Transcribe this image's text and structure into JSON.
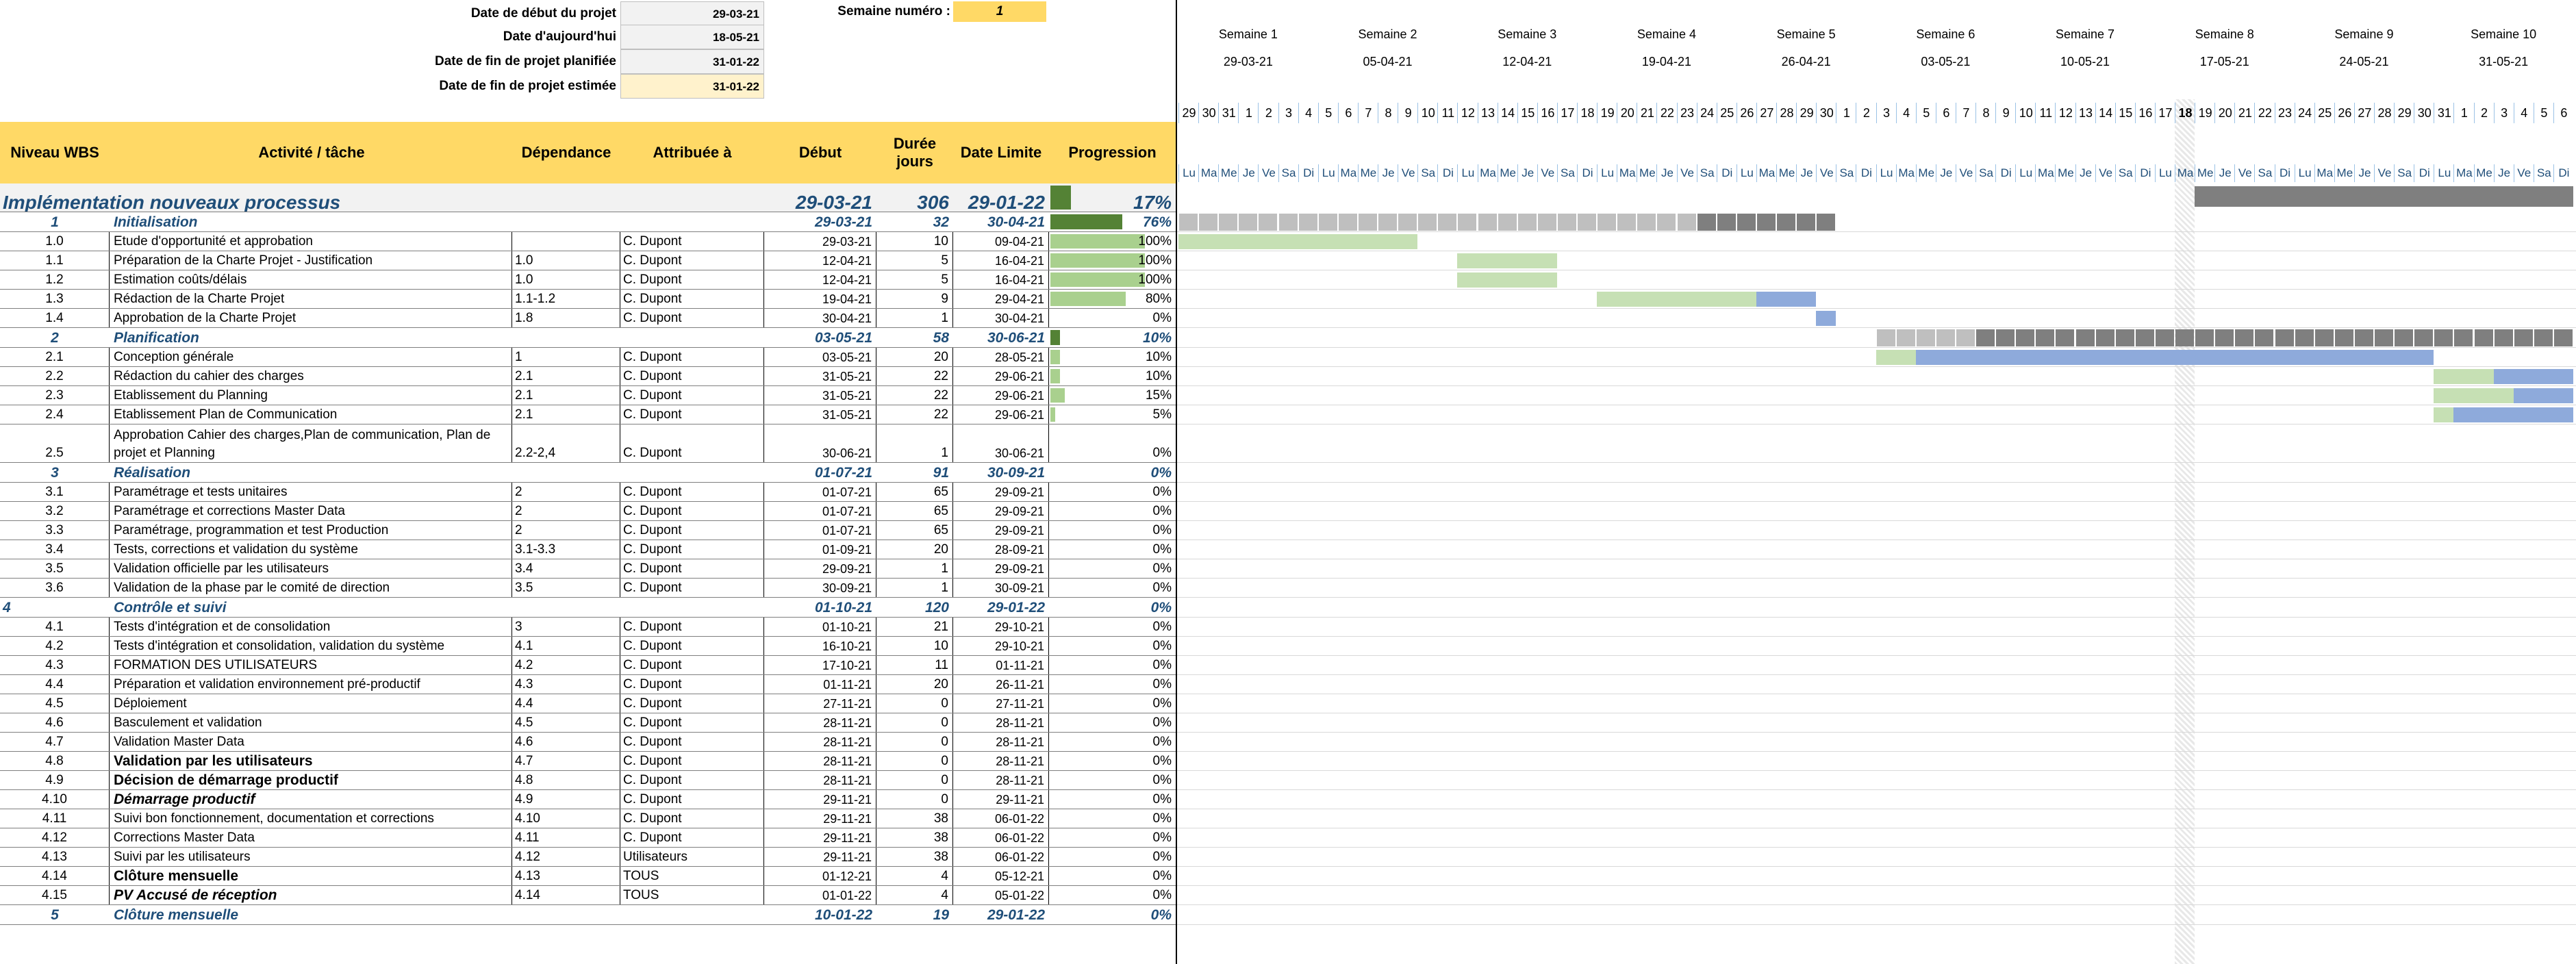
{
  "top": {
    "labels": [
      "Date de début du projet",
      "Date d'aujourd'hui",
      "Date de fin de projet planifiée",
      "Date de fin de projet estimée"
    ],
    "values": [
      "29-03-21",
      "18-05-21",
      "31-01-22",
      "31-01-22"
    ],
    "week_label": "Semaine numéro :",
    "week_value": "1"
  },
  "headers": {
    "wbs": "Niveau WBS",
    "activity": "Activité / tâche",
    "dependance": "Dépendance",
    "assigned": "Attribuée à",
    "start": "Début",
    "duration": "Durée jours",
    "deadline": "Date Limite",
    "progress": "Progression"
  },
  "project": {
    "name": "Implémentation nouveaux processus",
    "start": "29-03-21",
    "duration": "306",
    "deadline": "29-01-22",
    "progress": "17%",
    "progress_value": 17
  },
  "rows": [
    {
      "type": "phase",
      "wbs": "1",
      "task": "Initialisation",
      "dep": "",
      "who": "",
      "start": "29-03-21",
      "dur": "32",
      "end": "30-04-21",
      "prog": "76%",
      "pv": 76
    },
    {
      "type": "task",
      "wbs": "1.0",
      "task": "Etude d'opportunité et approbation",
      "dep": "",
      "who": "C. Dupont",
      "start": "29-03-21",
      "dur": "10",
      "end": "09-04-21",
      "prog": "100%",
      "pv": 100
    },
    {
      "type": "task",
      "wbs": "1.1",
      "task": "Préparation de la Charte Projet - Justification",
      "dep": "1.0",
      "who": "C. Dupont",
      "start": "12-04-21",
      "dur": "5",
      "end": "16-04-21",
      "prog": "100%",
      "pv": 100
    },
    {
      "type": "task",
      "wbs": "1.2",
      "task": "Estimation coûts/délais",
      "dep": "1.0",
      "who": "C. Dupont",
      "start": "12-04-21",
      "dur": "5",
      "end": "16-04-21",
      "prog": "100%",
      "pv": 100
    },
    {
      "type": "task",
      "wbs": "1.3",
      "task": "Rédaction de la Charte Projet",
      "dep": "1.1-1.2",
      "who": "C. Dupont",
      "start": "19-04-21",
      "dur": "9",
      "end": "29-04-21",
      "prog": "80%",
      "pv": 80
    },
    {
      "type": "task",
      "wbs": "1.4",
      "task": "Approbation de la Charte Projet",
      "dep": "1.8",
      "who": "C. Dupont",
      "start": "30-04-21",
      "dur": "1",
      "end": "30-04-21",
      "prog": "0%",
      "pv": 0
    },
    {
      "type": "phase",
      "wbs": "2",
      "task": "Planification",
      "dep": "",
      "who": "",
      "start": "03-05-21",
      "dur": "58",
      "end": "30-06-21",
      "prog": "10%",
      "pv": 10
    },
    {
      "type": "task",
      "wbs": "2.1",
      "task": "Conception générale",
      "dep": "1",
      "who": "C. Dupont",
      "start": "03-05-21",
      "dur": "20",
      "end": "28-05-21",
      "prog": "10%",
      "pv": 10
    },
    {
      "type": "task",
      "wbs": "2.2",
      "task": "Rédaction du cahier des charges",
      "dep": "2.1",
      "who": "C. Dupont",
      "start": "31-05-21",
      "dur": "22",
      "end": "29-06-21",
      "prog": "10%",
      "pv": 10
    },
    {
      "type": "task",
      "wbs": "2.3",
      "task": "Etablissement du Planning",
      "dep": "2.1",
      "who": "C. Dupont",
      "start": "31-05-21",
      "dur": "22",
      "end": "29-06-21",
      "prog": "15%",
      "pv": 15
    },
    {
      "type": "task",
      "wbs": "2.4",
      "task": "Etablissement Plan de Communication",
      "dep": "2.1",
      "who": "C. Dupont",
      "start": "31-05-21",
      "dur": "22",
      "end": "29-06-21",
      "prog": "5%",
      "pv": 5
    },
    {
      "type": "task2",
      "wbs": "2.5",
      "task": "Approbation Cahier des charges,Plan de communication, Plan de projet et Planning",
      "dep": "2.2-2,4",
      "who": "C. Dupont",
      "start": "30-06-21",
      "dur": "1",
      "end": "30-06-21",
      "prog": "0%",
      "pv": 0
    },
    {
      "type": "phase",
      "wbs": "3",
      "task": "Réalisation",
      "dep": "",
      "who": "",
      "start": "01-07-21",
      "dur": "91",
      "end": "30-09-21",
      "prog": "0%",
      "pv": 0
    },
    {
      "type": "task",
      "wbs": "3.1",
      "task": "Paramétrage et tests unitaires",
      "dep": "2",
      "who": "C. Dupont",
      "start": "01-07-21",
      "dur": "65",
      "end": "29-09-21",
      "prog": "0%",
      "pv": 0
    },
    {
      "type": "task",
      "wbs": "3.2",
      "task": "Paramétrage et corrections Master Data",
      "dep": "2",
      "who": "C. Dupont",
      "start": "01-07-21",
      "dur": "65",
      "end": "29-09-21",
      "prog": "0%",
      "pv": 0
    },
    {
      "type": "task",
      "wbs": "3.3",
      "task": "Paramétrage, programmation et test Production",
      "dep": "2",
      "who": "C. Dupont",
      "start": "01-07-21",
      "dur": "65",
      "end": "29-09-21",
      "prog": "0%",
      "pv": 0
    },
    {
      "type": "task",
      "wbs": "3.4",
      "task": "Tests, corrections et validation du système",
      "dep": "3.1-3.3",
      "who": "C. Dupont",
      "start": "01-09-21",
      "dur": "20",
      "end": "28-09-21",
      "prog": "0%",
      "pv": 0
    },
    {
      "type": "task",
      "wbs": "3.5",
      "task": "Validation officielle par les utilisateurs",
      "dep": "3.4",
      "who": "C. Dupont",
      "start": "29-09-21",
      "dur": "1",
      "end": "29-09-21",
      "prog": "0%",
      "pv": 0
    },
    {
      "type": "task",
      "wbs": "3.6",
      "task": "Validation de la phase par le comité de direction",
      "dep": "3.5",
      "who": "C. Dupont",
      "start": "30-09-21",
      "dur": "1",
      "end": "30-09-21",
      "prog": "0%",
      "pv": 0
    },
    {
      "type": "phase4",
      "wbs": "4",
      "task": "Contrôle et suivi",
      "dep": "",
      "who": "",
      "start": "01-10-21",
      "dur": "120",
      "end": "29-01-22",
      "prog": "0%",
      "pv": 0
    },
    {
      "type": "task",
      "wbs": "4.1",
      "task": "Tests d'intégration et de consolidation",
      "dep": "3",
      "who": "C. Dupont",
      "start": "01-10-21",
      "dur": "21",
      "end": "29-10-21",
      "prog": "0%",
      "pv": 0
    },
    {
      "type": "task",
      "wbs": "4.2",
      "task": "Tests d'intégration et consolidation, validation du système",
      "dep": "4.1",
      "who": "C. Dupont",
      "start": "16-10-21",
      "dur": "10",
      "end": "29-10-21",
      "prog": "0%",
      "pv": 0
    },
    {
      "type": "task",
      "wbs": "4.3",
      "task": "FORMATION DES UTILISATEURS",
      "dep": "4.2",
      "who": "C. Dupont",
      "start": "17-10-21",
      "dur": "11",
      "end": "01-11-21",
      "prog": "0%",
      "pv": 0
    },
    {
      "type": "task",
      "wbs": "4.4",
      "task": "Préparation et validation environnement pré-productif",
      "dep": "4.3",
      "who": "C. Dupont",
      "start": "01-11-21",
      "dur": "20",
      "end": "26-11-21",
      "prog": "0%",
      "pv": 0
    },
    {
      "type": "task",
      "wbs": "4.5",
      "task": "Déploiement",
      "dep": "4.4",
      "who": "C. Dupont",
      "start": "27-11-21",
      "dur": "0",
      "end": "27-11-21",
      "prog": "0%",
      "pv": 0
    },
    {
      "type": "task",
      "wbs": "4.6",
      "task": "Basculement et validation",
      "dep": "4.5",
      "who": "C. Dupont",
      "start": "28-11-21",
      "dur": "0",
      "end": "28-11-21",
      "prog": "0%",
      "pv": 0
    },
    {
      "type": "task",
      "wbs": "4.7",
      "task": "Validation Master Data",
      "dep": "4.6",
      "who": "C. Dupont",
      "start": "28-11-21",
      "dur": "0",
      "end": "28-11-21",
      "prog": "0%",
      "pv": 0
    },
    {
      "type": "taskb",
      "wbs": "4.8",
      "task": "Validation par les utilisateurs",
      "dep": "4.7",
      "who": "C. Dupont",
      "start": "28-11-21",
      "dur": "0",
      "end": "28-11-21",
      "prog": "0%",
      "pv": 0
    },
    {
      "type": "taskb",
      "wbs": "4.9",
      "task": "Décision de démarrage productif",
      "dep": "4.8",
      "who": "C. Dupont",
      "start": "28-11-21",
      "dur": "0",
      "end": "28-11-21",
      "prog": "0%",
      "pv": 0
    },
    {
      "type": "taskbi",
      "wbs": "4.10",
      "task": "Démarrage productif",
      "dep": "4.9",
      "who": "C. Dupont",
      "start": "29-11-21",
      "dur": "0",
      "end": "29-11-21",
      "prog": "0%",
      "pv": 0
    },
    {
      "type": "task",
      "wbs": "4.11",
      "task": "Suivi bon fonctionnement, documentation et corrections",
      "dep": "4.10",
      "who": "C. Dupont",
      "start": "29-11-21",
      "dur": "38",
      "end": "06-01-22",
      "prog": "0%",
      "pv": 0
    },
    {
      "type": "task",
      "wbs": "4.12",
      "task": "Corrections Master Data",
      "dep": "4.11",
      "who": "C. Dupont",
      "start": "29-11-21",
      "dur": "38",
      "end": "06-01-22",
      "prog": "0%",
      "pv": 0
    },
    {
      "type": "task",
      "wbs": "4.13",
      "task": "Suivi par les utilisateurs",
      "dep": "4.12",
      "who": "Utilisateurs",
      "start": "29-11-21",
      "dur": "38",
      "end": "06-01-22",
      "prog": "0%",
      "pv": 0
    },
    {
      "type": "taskb",
      "wbs": "4.14",
      "task": "Clôture mensuelle",
      "dep": "4.13",
      "who": "TOUS",
      "start": "01-12-21",
      "dur": "4",
      "end": "05-12-21",
      "prog": "0%",
      "pv": 0
    },
    {
      "type": "taskbi",
      "wbs": "4.15",
      "task": "PV Accusé de réception",
      "dep": "4.14",
      "who": "TOUS",
      "start": "01-01-22",
      "dur": "4",
      "end": "05-01-22",
      "prog": "0%",
      "pv": 0
    },
    {
      "type": "phase",
      "wbs": "5",
      "task": "Clôture mensuelle",
      "dep": "",
      "who": "",
      "start": "10-01-22",
      "dur": "19",
      "end": "29-01-22",
      "prog": "0%",
      "pv": 0
    }
  ],
  "gantt": {
    "weeks": [
      {
        "label": "Semaine 1",
        "date": "29-03-21"
      },
      {
        "label": "Semaine 2",
        "date": "05-04-21"
      },
      {
        "label": "Semaine 3",
        "date": "12-04-21"
      },
      {
        "label": "Semaine 4",
        "date": "19-04-21"
      },
      {
        "label": "Semaine 5",
        "date": "26-04-21"
      },
      {
        "label": "Semaine 6",
        "date": "03-05-21"
      },
      {
        "label": "Semaine 7",
        "date": "10-05-21"
      },
      {
        "label": "Semaine 8",
        "date": "17-05-21"
      },
      {
        "label": "Semaine 9",
        "date": "24-05-21"
      },
      {
        "label": "Semaine 10",
        "date": "31-05-21"
      }
    ],
    "day_numbers": [
      "29",
      "30",
      "31",
      "1",
      "2",
      "3",
      "4",
      "5",
      "6",
      "7",
      "8",
      "9",
      "10",
      "11",
      "12",
      "13",
      "14",
      "15",
      "16",
      "17",
      "18",
      "19",
      "20",
      "21",
      "22",
      "23",
      "24",
      "25",
      "26",
      "27",
      "28",
      "29",
      "30",
      "1",
      "2",
      "3",
      "4",
      "5",
      "6",
      "7",
      "8",
      "9",
      "10",
      "11",
      "12",
      "13",
      "14",
      "15",
      "16",
      "17",
      "18",
      "19",
      "20",
      "21",
      "22",
      "23",
      "24",
      "25",
      "26",
      "27",
      "28",
      "29",
      "30",
      "31",
      "1",
      "2",
      "3",
      "4",
      "5",
      "6"
    ],
    "day_names": [
      "Lu",
      "Ma",
      "Me",
      "Je",
      "Ve",
      "Sa",
      "Di"
    ],
    "today_index": 50,
    "colors": {
      "planned": "#c6e0b4",
      "remaining": "#8eaadb",
      "phase_light": "#bfbfbf",
      "phase_dark": "#7f7f7f",
      "header": "#ffd966",
      "progress": "#548235",
      "progress_light": "#a9d08e"
    }
  }
}
